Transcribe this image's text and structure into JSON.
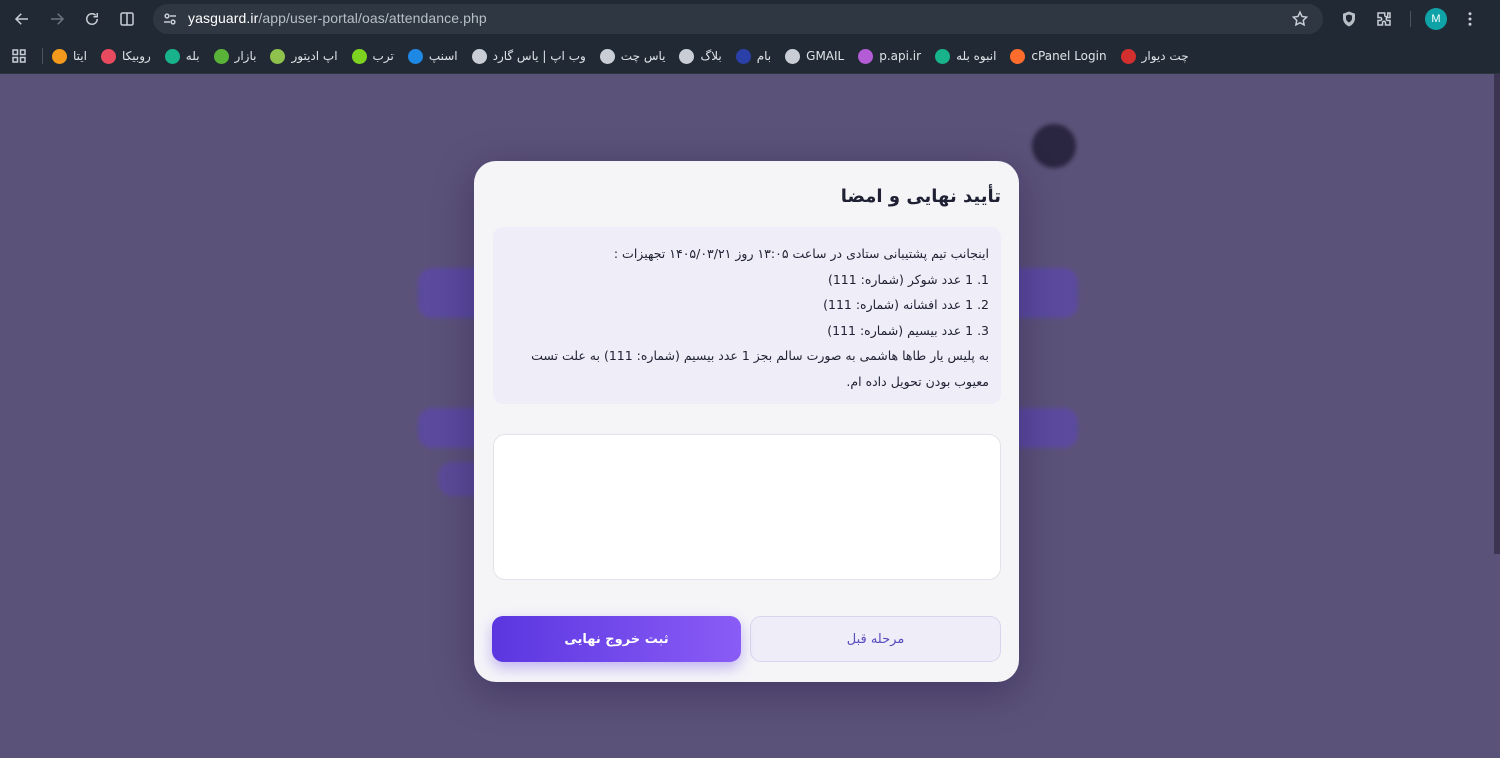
{
  "browser": {
    "url_host": "yasguard.ir",
    "url_path": "/app/user-portal/oas/attendance.php",
    "avatar_letter": "M",
    "bookmarks": [
      {
        "label": "ایتا",
        "color": "#f39a1d"
      },
      {
        "label": "روبیکا",
        "color": "#e84a5f"
      },
      {
        "label": "بله",
        "color": "#19b38b"
      },
      {
        "label": "بازار",
        "color": "#5ab339"
      },
      {
        "label": "اپ ادیتور",
        "color": "#8fc24d"
      },
      {
        "label": "ترب",
        "color": "#7ed321"
      },
      {
        "label": "اسنپ",
        "color": "#1e88e5"
      },
      {
        "label": "وب اپ | یاس گارد",
        "color": "#c9ced6"
      },
      {
        "label": "یاس چت",
        "color": "#c9ced6"
      },
      {
        "label": "بلاگ",
        "color": "#c9ced6"
      },
      {
        "label": "بام",
        "color": "#2b3fa8"
      },
      {
        "label": "GMAIL",
        "color": "#c9ced6"
      },
      {
        "label": "p.api.ir",
        "color": "#b45cd6"
      },
      {
        "label": "انبوه بله",
        "color": "#19b38b"
      },
      {
        "label": "cPanel Login",
        "color": "#ff6c2c"
      },
      {
        "label": "چت دیوار",
        "color": "#d32f2f"
      }
    ]
  },
  "modal": {
    "title": "تأیید نهایی و امضا",
    "notice_lines": [
      "اینجانب تیم پشتیبانی ستادی در ساعت ۱۳:۰۵ روز ۱۴۰۵/۰۳/۲۱ تجهیزات :",
      "1. 1 عدد شوکر (شماره: 111)",
      "2. 1 عدد افشانه (شماره: 111)",
      "3. 1 عدد بیسیم (شماره: 111)",
      "به پلیس یار طاها هاشمی به صورت سالم بجز 1 عدد بیسیم (شماره: 111) به علت تست معیوب بودن تحویل داده ام."
    ],
    "prev_button": "مرحله قبل",
    "submit_button": "ثبت خروج نهایی"
  },
  "colors": {
    "accent_start": "#5b36e0",
    "accent_end": "#8a5cf6",
    "overlay": "#5b5279"
  }
}
